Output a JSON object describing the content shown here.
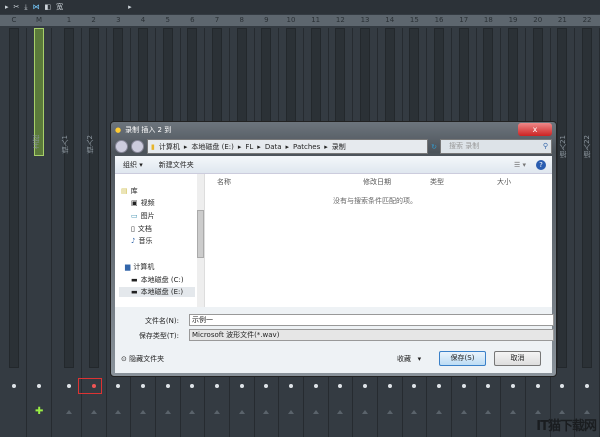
{
  "toolbar": {
    "label": "宽"
  },
  "mixer": {
    "channel_headers": [
      "C",
      "M",
      "1",
      "2",
      "3",
      "4",
      "5",
      "6",
      "7",
      "8",
      "9",
      "10",
      "11",
      "12",
      "13",
      "14",
      "15",
      "16",
      "17",
      "18",
      "19",
      "20",
      "21",
      "22"
    ],
    "track_labels": {
      "master": "主控",
      "insert1": "插入1",
      "insert2": "插入2",
      "insert21": "插入21",
      "insert22": "插入22"
    },
    "selected_route_highlight": "#d33333",
    "master_color": "#a8d06a"
  },
  "dialog": {
    "title": "录制 插入 2 到",
    "close": "x",
    "breadcrumb": [
      "计算机",
      "本地磁盘 (E:)",
      "FL",
      "Data",
      "Patches",
      "录制"
    ],
    "search_placeholder": "搜索 录制",
    "organize": "组织 ▾",
    "new_folder": "新建文件夹",
    "nav": [
      {
        "label": "库",
        "icon": "library-icon"
      },
      {
        "label": "视频",
        "icon": "video-icon"
      },
      {
        "label": "图片",
        "icon": "picture-icon"
      },
      {
        "label": "文档",
        "icon": "document-icon"
      },
      {
        "label": "音乐",
        "icon": "music-icon"
      },
      {
        "label": "计算机",
        "icon": "computer-icon"
      },
      {
        "label": "本地磁盘 (C:)",
        "icon": "drive-icon"
      },
      {
        "label": "本地磁盘 (E:)",
        "icon": "drive-icon"
      }
    ],
    "columns": [
      "名称",
      "修改日期",
      "类型",
      "大小"
    ],
    "empty_message": "没有与搜索条件匹配的项。",
    "filename_label": "文件名(N):",
    "filename_value": "示例一",
    "filetype_label": "保存类型(T):",
    "filetype_value": "Microsoft 波形文件(*.wav)",
    "hide_folders": "隐藏文件夹",
    "favorites": "收藏",
    "save": "保存(S)",
    "cancel": "取消"
  },
  "watermark": "IT猫下载网"
}
